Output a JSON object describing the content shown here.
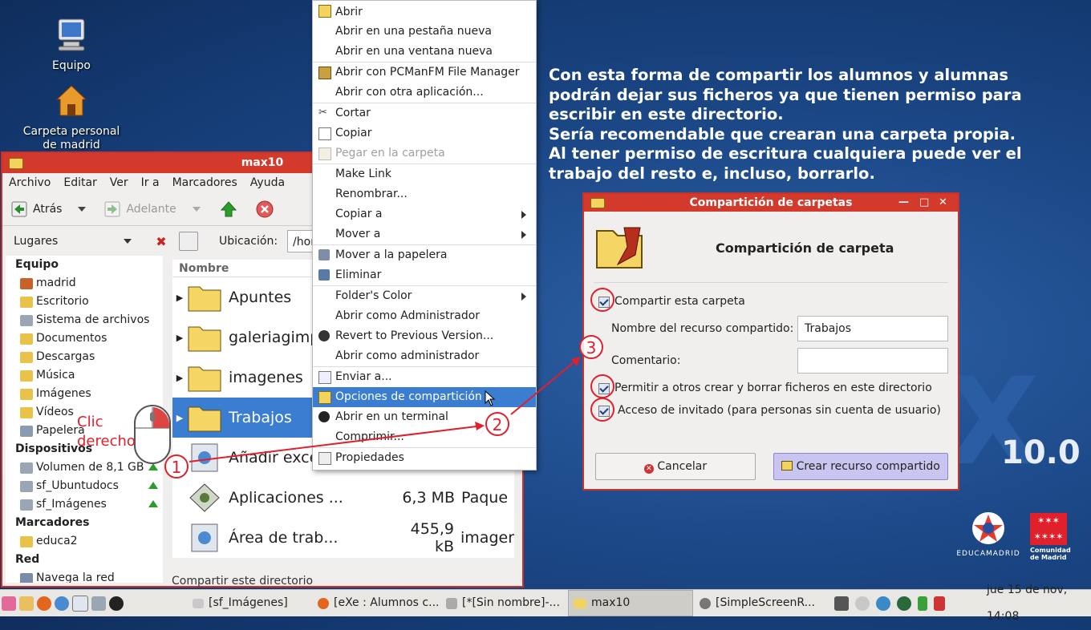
{
  "desktop": {
    "icons": [
      {
        "label": "Equipo"
      },
      {
        "label": "Carpeta personal de madrid"
      }
    ],
    "version": "10.0",
    "info_lines": [
      "Con esta forma de compartir los alumnos y alumnas",
      "podrán dejar sus ficheros ya que tienen permiso para",
      "escribir en este directorio.",
      "Sería recomendable que crearan una carpeta propia.",
      "Al  tener permiso de escritura cualquiera puede ver el",
      "trabajo del resto e, incluso, borrarlo."
    ]
  },
  "filemanager": {
    "title": "max10",
    "menu": [
      "Archivo",
      "Editar",
      "Ver",
      "Ir a",
      "Marcadores",
      "Ayuda"
    ],
    "back_label": "Atrás",
    "forward_label": "Adelante",
    "places_label": "Lugares",
    "location_label": "Ubicación:",
    "location_value": "/hom",
    "column_name": "Nombre",
    "sidebar": {
      "equipo": "Equipo",
      "equipo_items": [
        "madrid",
        "Escritorio",
        "Sistema de archivos",
        "Documentos",
        "Descargas",
        "Música",
        "Imágenes",
        "Vídeos",
        "Papelera"
      ],
      "dispositivos": "Dispositivos",
      "dispositivos_items": [
        "Volumen de 8,1 GB",
        "sf_Ubuntudocs",
        "sf_Imágenes"
      ],
      "marcadores": "Marcadores",
      "marcadores_items": [
        "educa2"
      ],
      "red": "Red",
      "red_items": [
        "Navega la red"
      ]
    },
    "rows": [
      {
        "name": "Apuntes",
        "size": "",
        "type": ""
      },
      {
        "name": "galeriagimp",
        "size": "",
        "type": ""
      },
      {
        "name": "imagenes",
        "size": "",
        "type": ""
      },
      {
        "name": "Trabajos",
        "size": "",
        "type": ""
      },
      {
        "name": "Añadir exce",
        "size": "",
        "type": ""
      },
      {
        "name": "Aplicaciones ...",
        "size": "6,3 MB",
        "type": "Paque"
      },
      {
        "name": "Área de trab...",
        "size": "455,9 kB",
        "type": "imager"
      }
    ],
    "status": "Compartir este directorio"
  },
  "context_menu": {
    "items": [
      {
        "label": "Abrir"
      },
      {
        "label": "Abrir en una pestaña nueva"
      },
      {
        "label": "Abrir en una ventana nueva"
      },
      {
        "label": "Abrir con PCManFM File Manager"
      },
      {
        "label": "Abrir con otra aplicación..."
      },
      {
        "label": "Cortar"
      },
      {
        "label": "Copiar"
      },
      {
        "label": "Pegar en la carpeta"
      },
      {
        "label": "Make Link"
      },
      {
        "label": "Renombrar..."
      },
      {
        "label": "Copiar a"
      },
      {
        "label": "Mover a"
      },
      {
        "label": "Mover a la papelera"
      },
      {
        "label": "Eliminar"
      },
      {
        "label": "Folder's Color"
      },
      {
        "label": "Abrir como Administrador"
      },
      {
        "label": "Revert to Previous Version..."
      },
      {
        "label": "Abrir como administrador"
      },
      {
        "label": "Enviar a..."
      },
      {
        "label": "Opciones de compartición"
      },
      {
        "label": "Abrir en un terminal"
      },
      {
        "label": "Comprimir..."
      },
      {
        "label": "Propiedades"
      }
    ]
  },
  "dialog": {
    "title": "Compartición de carpetas",
    "heading": "Compartición de carpeta",
    "share_label": "Compartir esta carpeta",
    "share_name_label": "Nombre del recurso compartido:",
    "share_name_value": "Trabajos",
    "comment_label": "Comentario:",
    "comment_value": "",
    "allow_write_label": "Permitir a otros crear y borrar ficheros en este directorio",
    "guest_label": "Acceso de invitado (para personas sin cuenta de usuario)",
    "cancel_label": "Cancelar",
    "create_label": "Crear recurso compartido"
  },
  "annotations": {
    "click_line1": "Clic",
    "click_line2": "derecho",
    "step1": "1",
    "step2": "2",
    "step3": "3"
  },
  "taskbar": {
    "items": [
      "[sf_Imágenes]",
      "[eXe : Alumnos c...",
      "[*[Sin nombre]-...",
      "max10",
      "[SimpleScreenR..."
    ],
    "clock": "jue 15 de nov, 14:08"
  },
  "logos": {
    "educamadrid": "EDUCAMADRID",
    "comunidad": "Comunidad de Madrid"
  },
  "colors": {
    "accent": "#3b7dd1",
    "titlebar": "#d33a2c",
    "annotation": "#e0202a"
  }
}
